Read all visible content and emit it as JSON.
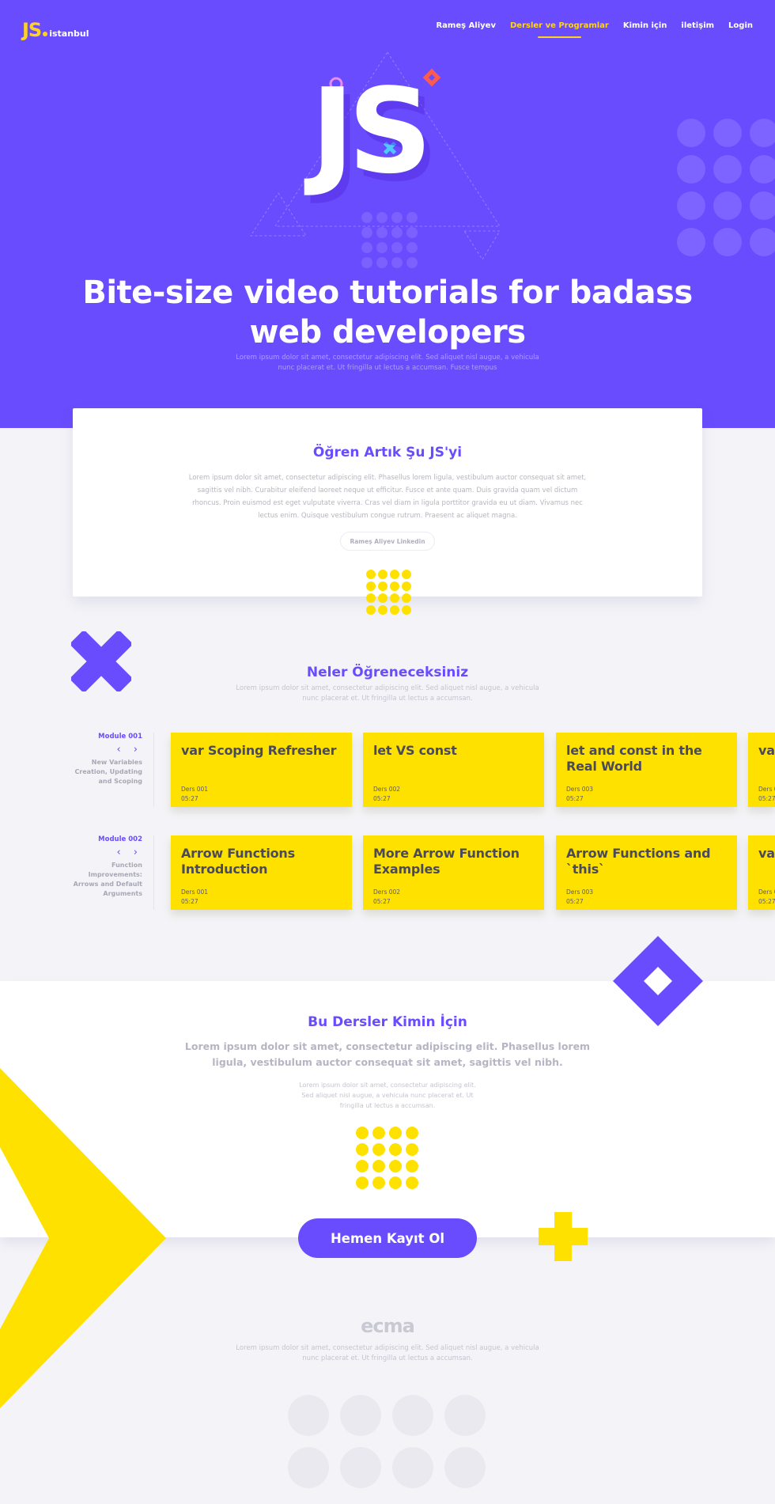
{
  "brand": {
    "logo_mark": "JS",
    "logo_text": "istanbul",
    "logo_color": "#ffd21f"
  },
  "colors": {
    "primary": "#6a4cff",
    "accent": "#ffe100",
    "bg": "#f4f4f8"
  },
  "nav": {
    "items": [
      {
        "label": "Rameş Aliyev",
        "active": false
      },
      {
        "label": "Dersler ve Programlar",
        "active": true
      },
      {
        "label": "Kimin için",
        "active": false
      },
      {
        "label": "iletişim",
        "active": false
      },
      {
        "label": "Login",
        "active": false
      }
    ]
  },
  "hero": {
    "big_mark": "JS",
    "title_line1": "Bite-size video tutorials for badass",
    "title_line2": "web developers",
    "subtitle": "Lorem ipsum dolor sit amet, consectetur adipiscing elit. Sed aliquet nisl augue, a vehicula nunc placerat et. Ut fringilla ut lectus a accumsan. Fusce tempus"
  },
  "intro": {
    "title": "Öğren Artık Şu JS'yi",
    "text": "Lorem ipsum dolor sit amet, consectetur adipiscing elit. Phasellus lorem ligula, vestibulum auctor consequat sit amet, sagittis vel nibh. Curabitur eleifend laoreet neque ut efficitur. Fusce et ante quam. Duis gravida quam vel dictum rhoncus. Proin euismod est eget vulputate viverra. Cras vel diam in ligula porttitor gravida eu ut diam. Vivamus nec lectus enim. Quisque vestibulum congue rutrum. Praesent ac aliquet magna.",
    "button": "Rameş Aliyev Linkedin"
  },
  "learn": {
    "title": "Neler Öğreneceksiniz",
    "subtitle": "Lorem ipsum dolor sit amet, consectetur adipiscing elit. Sed aliquet nisl augue, a vehicula nunc placerat et. Ut fringilla ut lectus a accumsan."
  },
  "modules": [
    {
      "label": "Module 001",
      "description": "New Variables Creation, Updating and Scoping",
      "arrows": "‹ ›",
      "lessons": [
        {
          "title": "var Scoping Refresher",
          "num": "Ders 001",
          "time": "05:27"
        },
        {
          "title": "let VS const",
          "num": "Ders 002",
          "time": "05:27"
        },
        {
          "title": "let and const in the Real World",
          "num": "Ders 003",
          "time": "05:27"
        },
        {
          "title": "va",
          "num": "Ders 0",
          "time": "05:27"
        }
      ]
    },
    {
      "label": "Module 002",
      "description": "Function Improvements: Arrows and Default Arguments",
      "arrows": "‹ ›",
      "lessons": [
        {
          "title": "Arrow Functions Introduction",
          "num": "Ders 001",
          "time": "05:27"
        },
        {
          "title": "More Arrow Function Examples",
          "num": "Ders 002",
          "time": "05:27"
        },
        {
          "title": "Arrow Functions and `this`",
          "num": "Ders 003",
          "time": "05:27"
        },
        {
          "title": "va",
          "num": "Ders 0",
          "time": "05:27"
        }
      ]
    }
  ],
  "audience": {
    "title": "Bu Dersler Kimin İçin",
    "lead": "Lorem ipsum dolor sit amet, consectetur adipiscing elit. Phasellus lorem ligula, vestibulum auctor consequat sit amet, sagittis vel nibh.",
    "text": "Lorem ipsum dolor sit amet, consectetur adipiscing elit. Sed aliquet nisl augue, a vehicula nunc placerat et. Ut fringilla ut lectus a accumsan.",
    "cta": "Hemen Kayıt Ol"
  },
  "footer": {
    "logo": "ecma",
    "text": "Lorem ipsum dolor sit amet, consectetur adipiscing elit. Sed aliquet nisl augue, a vehicula nunc placerat et. Ut fringilla ut lectus a accumsan."
  }
}
